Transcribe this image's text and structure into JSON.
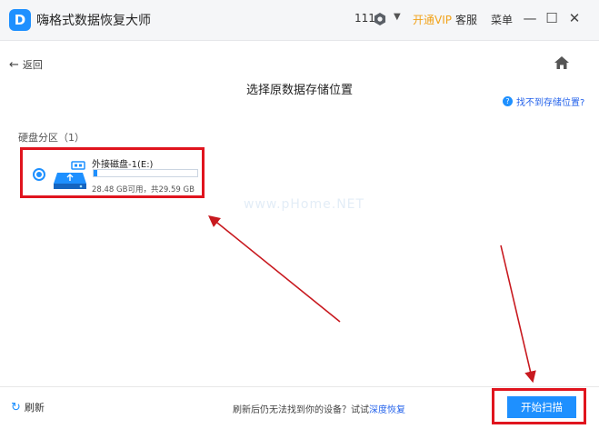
{
  "titlebar": {
    "app_title": "嗨格式数据恢复大师",
    "user_id": "111",
    "dropdown_glyph": "▼",
    "vip_label": "开通VIP",
    "support_label": "客服",
    "menu_label": "菜单",
    "minimize_glyph": "—",
    "maximize_glyph": "☐",
    "close_glyph": "✕"
  },
  "nav": {
    "back_arrow": "←",
    "back_label": "返回"
  },
  "main": {
    "title": "选择原数据存储位置",
    "help_link": "找不到存储位置?",
    "section_label": "硬盘分区（1）",
    "disk": {
      "name": "外接磁盘-1(E:)",
      "size_text": "28.48 GB可用，共29.59 GB",
      "used_fraction": 0.038
    },
    "watermark": "www.pHome.NET"
  },
  "footer": {
    "refresh_label": "刷新",
    "hint_text": "刷新后仍无法找到你的设备？试试",
    "hint_link": "深度恢复",
    "start_label": "开始扫描"
  },
  "colors": {
    "accent": "#1e90ff",
    "vip": "#f2a31b",
    "annotation": "#e0141e"
  }
}
